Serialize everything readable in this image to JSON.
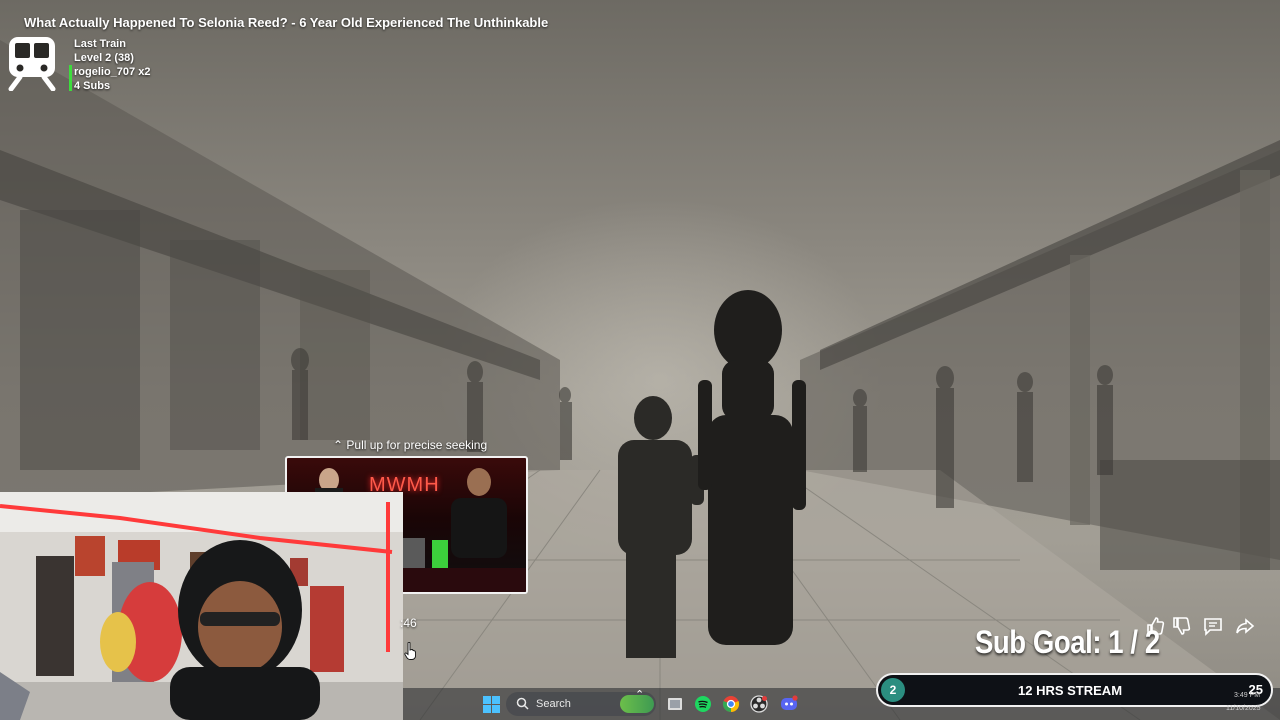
{
  "video": {
    "title": "What Actually Happened To Selonia Reed? - 6 Year Old Experienced The Unthinkable"
  },
  "alert": {
    "icon": "train-icon",
    "line1": "Last Train",
    "line2": "Level 2  (38)",
    "line3": "rogelio_707 x2",
    "line4": "4 Subs",
    "accent": "#3ddc3d"
  },
  "seek_tip": {
    "label": "Pull up for precise seeking",
    "icon": "chevron-up-icon"
  },
  "preview": {
    "sign_text": "MWMH"
  },
  "player": {
    "time_text": ":46"
  },
  "actions": {
    "like": "thumbs-up-icon",
    "dislike": "thumbs-down-icon",
    "comment": "comment-icon",
    "share": "share-icon"
  },
  "sub_goal": {
    "text": "Sub Goal:  1 / 2"
  },
  "taskbar": {
    "search_label": "Search",
    "apps": [
      "windows-start-icon",
      "search-icon",
      "files-icon",
      "spotify-icon",
      "chrome-icon",
      "obs-icon",
      "discord-icon"
    ]
  },
  "stream_bar": {
    "count": "2",
    "label": "12 HRS STREAM",
    "number": "25",
    "accent": "#2b8e80"
  },
  "clock": {
    "time": "3:49 PM",
    "date": "11/10/2025"
  }
}
